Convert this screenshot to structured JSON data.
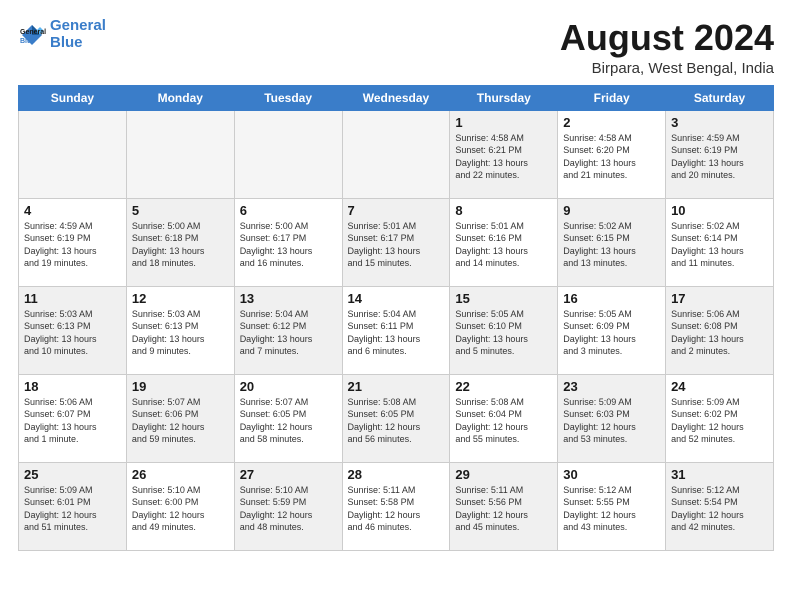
{
  "logo": {
    "line1": "General",
    "line2": "Blue"
  },
  "title": {
    "month_year": "August 2024",
    "location": "Birpara, West Bengal, India"
  },
  "days_of_week": [
    "Sunday",
    "Monday",
    "Tuesday",
    "Wednesday",
    "Thursday",
    "Friday",
    "Saturday"
  ],
  "weeks": [
    [
      {
        "day": "",
        "info": "",
        "empty": true
      },
      {
        "day": "",
        "info": "",
        "empty": true
      },
      {
        "day": "",
        "info": "",
        "empty": true
      },
      {
        "day": "",
        "info": "",
        "empty": true
      },
      {
        "day": "1",
        "info": "Sunrise: 4:58 AM\nSunset: 6:21 PM\nDaylight: 13 hours\nand 22 minutes."
      },
      {
        "day": "2",
        "info": "Sunrise: 4:58 AM\nSunset: 6:20 PM\nDaylight: 13 hours\nand 21 minutes."
      },
      {
        "day": "3",
        "info": "Sunrise: 4:59 AM\nSunset: 6:19 PM\nDaylight: 13 hours\nand 20 minutes."
      }
    ],
    [
      {
        "day": "4",
        "info": "Sunrise: 4:59 AM\nSunset: 6:19 PM\nDaylight: 13 hours\nand 19 minutes."
      },
      {
        "day": "5",
        "info": "Sunrise: 5:00 AM\nSunset: 6:18 PM\nDaylight: 13 hours\nand 18 minutes."
      },
      {
        "day": "6",
        "info": "Sunrise: 5:00 AM\nSunset: 6:17 PM\nDaylight: 13 hours\nand 16 minutes."
      },
      {
        "day": "7",
        "info": "Sunrise: 5:01 AM\nSunset: 6:17 PM\nDaylight: 13 hours\nand 15 minutes."
      },
      {
        "day": "8",
        "info": "Sunrise: 5:01 AM\nSunset: 6:16 PM\nDaylight: 13 hours\nand 14 minutes."
      },
      {
        "day": "9",
        "info": "Sunrise: 5:02 AM\nSunset: 6:15 PM\nDaylight: 13 hours\nand 13 minutes."
      },
      {
        "day": "10",
        "info": "Sunrise: 5:02 AM\nSunset: 6:14 PM\nDaylight: 13 hours\nand 11 minutes."
      }
    ],
    [
      {
        "day": "11",
        "info": "Sunrise: 5:03 AM\nSunset: 6:13 PM\nDaylight: 13 hours\nand 10 minutes."
      },
      {
        "day": "12",
        "info": "Sunrise: 5:03 AM\nSunset: 6:13 PM\nDaylight: 13 hours\nand 9 minutes."
      },
      {
        "day": "13",
        "info": "Sunrise: 5:04 AM\nSunset: 6:12 PM\nDaylight: 13 hours\nand 7 minutes."
      },
      {
        "day": "14",
        "info": "Sunrise: 5:04 AM\nSunset: 6:11 PM\nDaylight: 13 hours\nand 6 minutes."
      },
      {
        "day": "15",
        "info": "Sunrise: 5:05 AM\nSunset: 6:10 PM\nDaylight: 13 hours\nand 5 minutes."
      },
      {
        "day": "16",
        "info": "Sunrise: 5:05 AM\nSunset: 6:09 PM\nDaylight: 13 hours\nand 3 minutes."
      },
      {
        "day": "17",
        "info": "Sunrise: 5:06 AM\nSunset: 6:08 PM\nDaylight: 13 hours\nand 2 minutes."
      }
    ],
    [
      {
        "day": "18",
        "info": "Sunrise: 5:06 AM\nSunset: 6:07 PM\nDaylight: 13 hours\nand 1 minute."
      },
      {
        "day": "19",
        "info": "Sunrise: 5:07 AM\nSunset: 6:06 PM\nDaylight: 12 hours\nand 59 minutes."
      },
      {
        "day": "20",
        "info": "Sunrise: 5:07 AM\nSunset: 6:05 PM\nDaylight: 12 hours\nand 58 minutes."
      },
      {
        "day": "21",
        "info": "Sunrise: 5:08 AM\nSunset: 6:05 PM\nDaylight: 12 hours\nand 56 minutes."
      },
      {
        "day": "22",
        "info": "Sunrise: 5:08 AM\nSunset: 6:04 PM\nDaylight: 12 hours\nand 55 minutes."
      },
      {
        "day": "23",
        "info": "Sunrise: 5:09 AM\nSunset: 6:03 PM\nDaylight: 12 hours\nand 53 minutes."
      },
      {
        "day": "24",
        "info": "Sunrise: 5:09 AM\nSunset: 6:02 PM\nDaylight: 12 hours\nand 52 minutes."
      }
    ],
    [
      {
        "day": "25",
        "info": "Sunrise: 5:09 AM\nSunset: 6:01 PM\nDaylight: 12 hours\nand 51 minutes."
      },
      {
        "day": "26",
        "info": "Sunrise: 5:10 AM\nSunset: 6:00 PM\nDaylight: 12 hours\nand 49 minutes."
      },
      {
        "day": "27",
        "info": "Sunrise: 5:10 AM\nSunset: 5:59 PM\nDaylight: 12 hours\nand 48 minutes."
      },
      {
        "day": "28",
        "info": "Sunrise: 5:11 AM\nSunset: 5:58 PM\nDaylight: 12 hours\nand 46 minutes."
      },
      {
        "day": "29",
        "info": "Sunrise: 5:11 AM\nSunset: 5:56 PM\nDaylight: 12 hours\nand 45 minutes."
      },
      {
        "day": "30",
        "info": "Sunrise: 5:12 AM\nSunset: 5:55 PM\nDaylight: 12 hours\nand 43 minutes."
      },
      {
        "day": "31",
        "info": "Sunrise: 5:12 AM\nSunset: 5:54 PM\nDaylight: 12 hours\nand 42 minutes."
      }
    ]
  ]
}
